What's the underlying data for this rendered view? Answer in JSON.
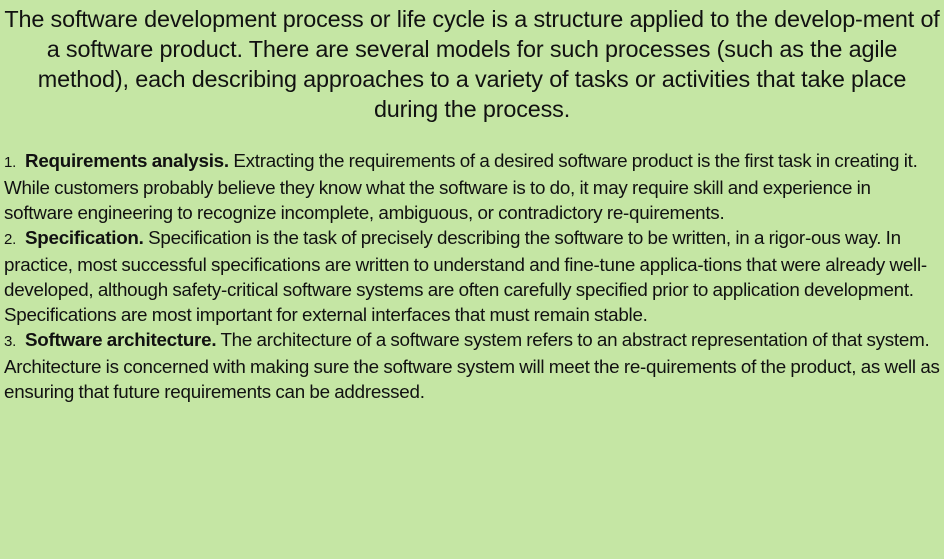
{
  "intro": "The software development process or life cycle is a structure applied to the develop-ment of a software product. There are several models for such processes (such as the agile method), each describing approaches to a variety of tasks or activities that take place during the process.",
  "steps": [
    {
      "number": "1.",
      "title": "Requirements analysis.",
      "text": "Extracting the requirements of a desired software product is the first task in creating it. While customers probably believe they know what the software is to do, it may require skill and experience in software engineering to recognize incomplete, ambiguous, or contradictory re-quirements."
    },
    {
      "number": "2.",
      "title": "Specification.",
      "text": "Specification is the task of precisely describing the software to be written, in a rigor-ous way. In practice, most successful specifications are written to understand and fine-tune applica-tions that were already well-developed, although safety-critical software systems are often carefully specified prior to application development. Specifications are most important for external interfaces that must remain stable."
    },
    {
      "number": "3.",
      "title": "Software architecture.",
      "text": "The architecture of a software system refers to an abstract representation of that system. Architecture is concerned with making sure the software system will meet the re-quirements of the product, as well as ensuring that future requirements can be addressed."
    }
  ]
}
